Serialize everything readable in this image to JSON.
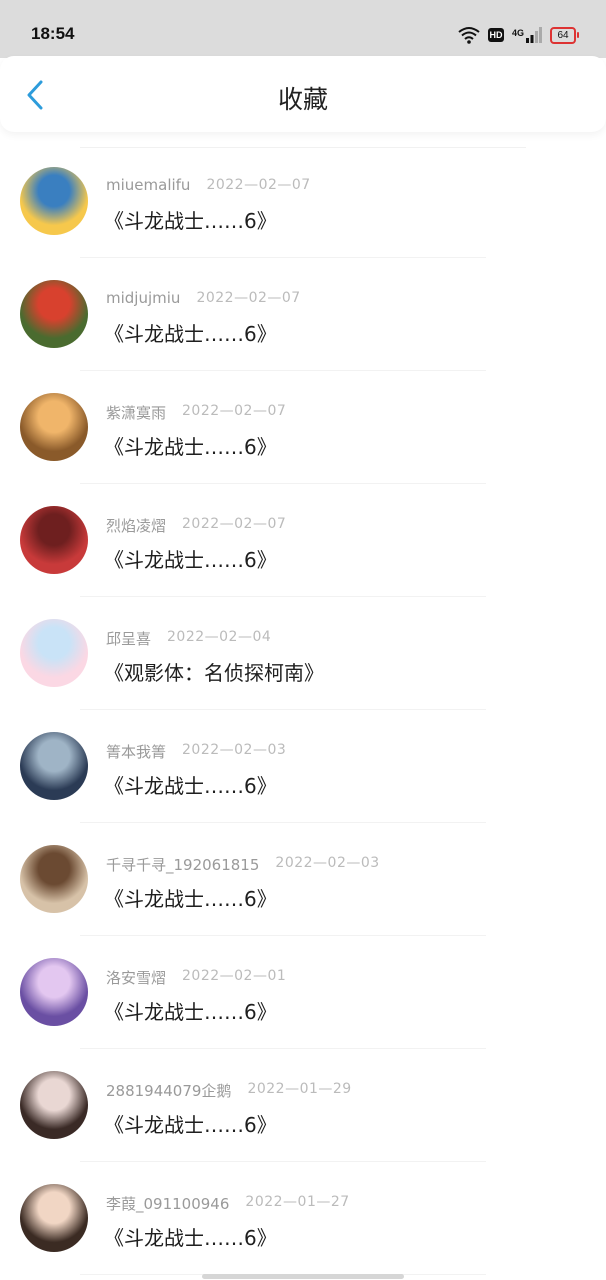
{
  "status_bar": {
    "time": "18:54",
    "hd_label": "HD",
    "network_label": "4G",
    "battery_level": "64",
    "icons": [
      "wifi-icon",
      "hd-icon",
      "signal-icon",
      "battery-icon"
    ]
  },
  "header": {
    "back_icon": "chevron-left-icon",
    "title": "收藏"
  },
  "colors": {
    "accent": "#2d9cdb",
    "username": "#9a9a9a",
    "date": "#bbbbbb",
    "title": "#1f1f1f"
  },
  "items": [
    {
      "user": "miuemalifu",
      "date": "2022—02—07",
      "title": "《斗龙战士……6》",
      "avatar_colors": [
        "#f6c84c",
        "#3a7fc0"
      ]
    },
    {
      "user": "midjujmiu",
      "date": "2022—02—07",
      "title": "《斗龙战士……6》",
      "avatar_colors": [
        "#4a6b2f",
        "#d8412e"
      ]
    },
    {
      "user": "紫潇寞雨",
      "date": "2022—02—07",
      "title": "《斗龙战士……6》",
      "avatar_colors": [
        "#8a5a2a",
        "#f0b56a"
      ]
    },
    {
      "user": "烈焰凌熠",
      "date": "2022—02—07",
      "title": "《斗龙战士……6》",
      "avatar_colors": [
        "#c83a3a",
        "#6e1f1f"
      ]
    },
    {
      "user": "邱呈喜",
      "date": "2022—02—04",
      "title": "《观影体：名侦探柯南》",
      "avatar_colors": [
        "#fbd8e4",
        "#c9e3f7"
      ]
    },
    {
      "user": "箐本我箐",
      "date": "2022—02—03",
      "title": "《斗龙战士……6》",
      "avatar_colors": [
        "#2b3b55",
        "#9fb4c6"
      ]
    },
    {
      "user": "千寻千寻_192061815",
      "date": "2022—02—03",
      "title": "《斗龙战士……6》",
      "avatar_colors": [
        "#d7c2a8",
        "#6b4a32"
      ]
    },
    {
      "user": "洛安雪熠",
      "date": "2022—02—01",
      "title": "《斗龙战士……6》",
      "avatar_colors": [
        "#6a4fa3",
        "#e3c7f0"
      ]
    },
    {
      "user": "2881944079企鹅",
      "date": "2022—01—29",
      "title": "《斗龙战士……6》",
      "avatar_colors": [
        "#3a2a26",
        "#e9d7d3"
      ]
    },
    {
      "user": "李葭_091100946",
      "date": "2022—01—27",
      "title": "《斗龙战士……6》",
      "avatar_colors": [
        "#3b2b23",
        "#f1d6c4"
      ]
    }
  ]
}
